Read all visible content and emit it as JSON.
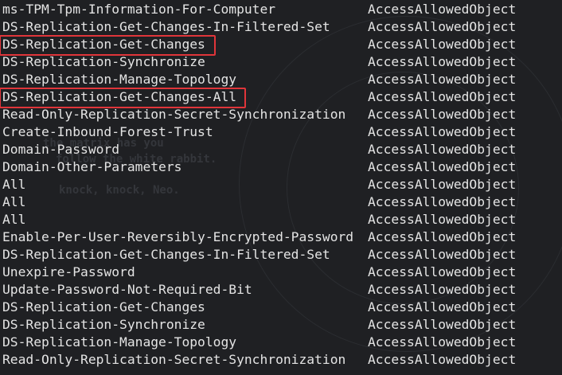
{
  "terminal": {
    "rows": [
      {
        "name": "ms-TPM-Tpm-Information-For-Computer",
        "type": "AccessAllowedObject"
      },
      {
        "name": "DS-Replication-Get-Changes-In-Filtered-Set",
        "type": "AccessAllowedObject"
      },
      {
        "name": "DS-Replication-Get-Changes",
        "type": "AccessAllowedObject",
        "highlighted": true
      },
      {
        "name": "DS-Replication-Synchronize",
        "type": "AccessAllowedObject"
      },
      {
        "name": "DS-Replication-Manage-Topology",
        "type": "AccessAllowedObject"
      },
      {
        "name": "DS-Replication-Get-Changes-All",
        "type": "AccessAllowedObject",
        "highlighted": true
      },
      {
        "name": "Read-Only-Replication-Secret-Synchronization",
        "type": "AccessAllowedObject"
      },
      {
        "name": "Create-Inbound-Forest-Trust",
        "type": "AccessAllowedObject"
      },
      {
        "name": "Domain-Password",
        "type": "AccessAllowedObject"
      },
      {
        "name": "Domain-Other-Parameters",
        "type": "AccessAllowedObject"
      },
      {
        "name": "All",
        "type": "AccessAllowedObject"
      },
      {
        "name": "All",
        "type": "AccessAllowedObject"
      },
      {
        "name": "All",
        "type": "AccessAllowedObject"
      },
      {
        "name": "Enable-Per-User-Reversibly-Encrypted-Password",
        "type": "AccessAllowedObject"
      },
      {
        "name": "DS-Replication-Get-Changes-In-Filtered-Set",
        "type": "AccessAllowedObject"
      },
      {
        "name": "Unexpire-Password",
        "type": "AccessAllowedObject"
      },
      {
        "name": "Update-Password-Not-Required-Bit",
        "type": "AccessAllowedObject"
      },
      {
        "name": "DS-Replication-Get-Changes",
        "type": "AccessAllowedObject"
      },
      {
        "name": "DS-Replication-Synchronize",
        "type": "AccessAllowedObject"
      },
      {
        "name": "DS-Replication-Manage-Topology",
        "type": "AccessAllowedObject"
      },
      {
        "name": "Read-Only-Replication-Secret-Synchronization",
        "type": "AccessAllowedObject"
      }
    ]
  },
  "wallpaper": {
    "line1": "the matrix has you",
    "line2": "follow the white rabbit.",
    "line3": "knock, knock, Neo."
  },
  "colors": {
    "background": "#1f2023",
    "text": "#e4e4e4",
    "highlight_border": "#e0353a"
  }
}
